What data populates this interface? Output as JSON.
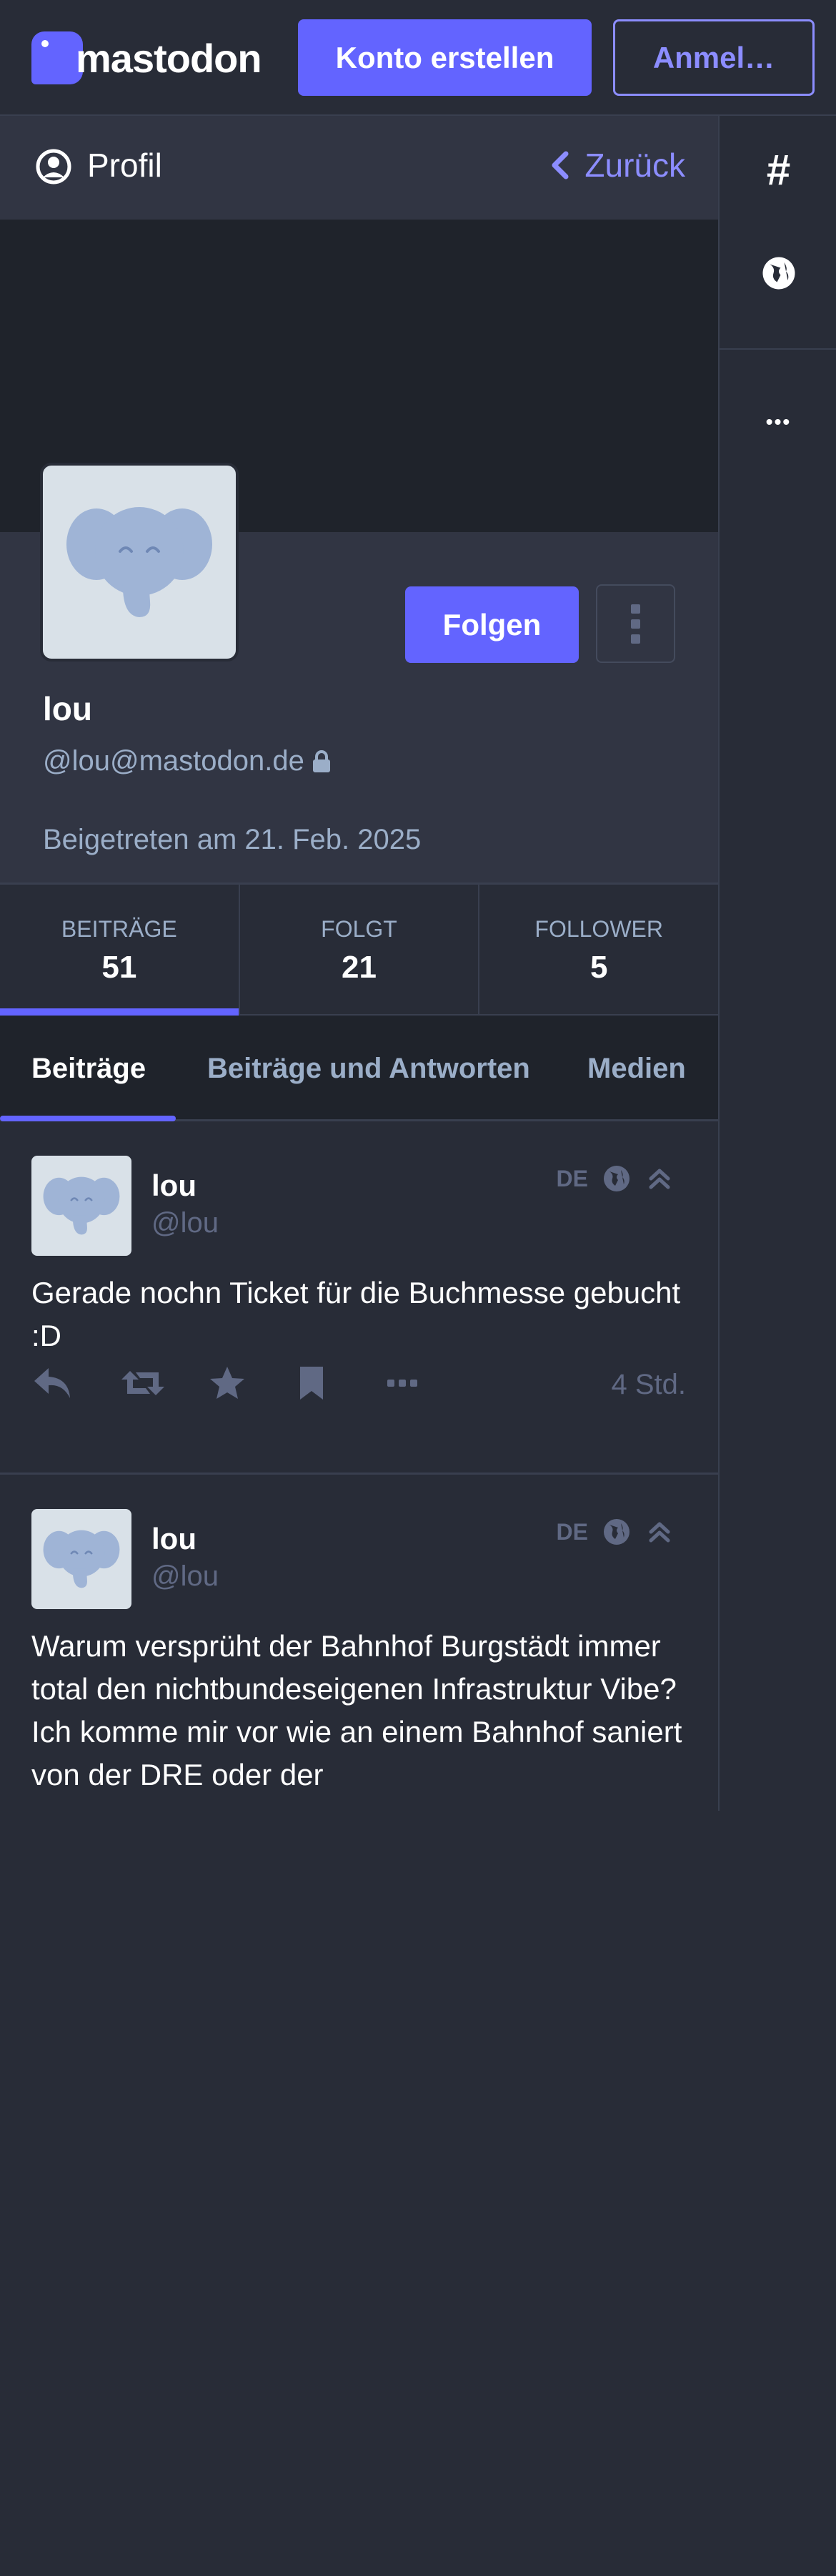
{
  "topbar": {
    "logo_text": "mastodon",
    "create_account": "Konto erstellen",
    "login": "Anmel…"
  },
  "column_header": {
    "title": "Profil",
    "back": "Zurück"
  },
  "sidebar": {
    "hashtag_icon": "#",
    "more_icon": "•••"
  },
  "profile": {
    "display_name": "lou",
    "account": "@lou@mastodon.de",
    "joined": "Beigetreten am 21. Feb. 2025",
    "follow_label": "Folgen",
    "locked": true
  },
  "counters": [
    {
      "label": "BEITRÄGE",
      "value": "51",
      "active": true
    },
    {
      "label": "FOLGT",
      "value": "21",
      "active": false
    },
    {
      "label": "FOLLOWER",
      "value": "5",
      "active": false
    }
  ],
  "tabs": [
    {
      "label": "Beiträge",
      "active": true
    },
    {
      "label": "Beiträge und Antworten",
      "active": false
    },
    {
      "label": "Medien",
      "active": false
    }
  ],
  "statuses": [
    {
      "name": "lou",
      "handle": "@lou",
      "lang": "DE",
      "content": "Gerade nochn Ticket für die Buchmesse gebucht :D",
      "time": "4 Std."
    },
    {
      "name": "lou",
      "handle": "@lou",
      "lang": "DE",
      "content": "Warum versprüht der Bahnhof Burgstädt immer total den nichtbundeseigenen Infrastruktur Vibe? Ich komme mir vor wie an einem Bahnhof saniert von der DRE oder der",
      "time": ""
    }
  ],
  "colors": {
    "accent": "#6364ff",
    "accent_light": "#8c8dff",
    "background": "#282c37",
    "panel": "#313543",
    "muted_text": "#9baec8",
    "dim_text": "#606984"
  }
}
